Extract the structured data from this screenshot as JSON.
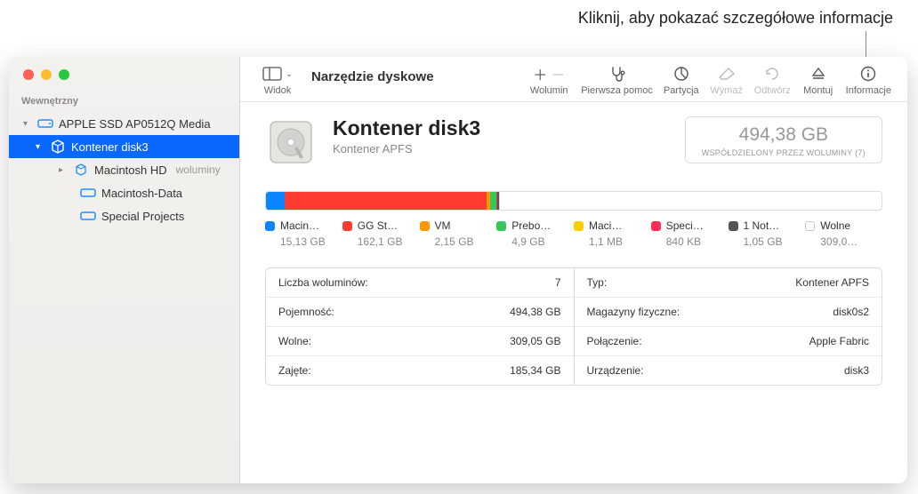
{
  "callout": "Kliknij, aby pokazać szczegółowe informacje",
  "toolbar": {
    "title": "Narzędzie dyskowe",
    "view": "Widok",
    "volume": "Wolumin",
    "firstaid": "Pierwsza pomoc",
    "partition": "Partycja",
    "erase": "Wymaż",
    "restore": "Odtwórz",
    "mount": "Montuj",
    "info": "Informacje"
  },
  "sidebar": {
    "section": "Wewnętrzny",
    "items": [
      {
        "label": "APPLE SSD AP0512Q Media"
      },
      {
        "label": "Kontener disk3"
      },
      {
        "label": "Macintosh HD",
        "suffix": "woluminy"
      },
      {
        "label": "Macintosh-Data"
      },
      {
        "label": "Special Projects"
      }
    ]
  },
  "disk": {
    "title": "Kontener disk3",
    "subtitle": "Kontener APFS",
    "size": "494,38 GB",
    "shared": "WSPÓŁDZIELONY PRZEZ WOLUMINY (7)"
  },
  "segments": [
    {
      "name": "Macin…",
      "size": "15,13 GB",
      "color": "#0a84ff",
      "pct": 3.1
    },
    {
      "name": "GG St…",
      "size": "162,1 GB",
      "color": "#ff3b30",
      "pct": 32.8
    },
    {
      "name": "VM",
      "size": "2,15 GB",
      "color": "#ff9500",
      "pct": 0.5
    },
    {
      "name": "Prebo…",
      "size": "4,9 GB",
      "color": "#34c759",
      "pct": 1.0
    },
    {
      "name": "Maci…",
      "size": "1,1 MB",
      "color": "#ffcc00",
      "pct": 0.1
    },
    {
      "name": "Speci…",
      "size": "840 KB",
      "color": "#ff2d55",
      "pct": 0.1
    },
    {
      "name": "1 Not…",
      "size": "1,05 GB",
      "color": "#555555",
      "pct": 0.3
    },
    {
      "name": "Wolne",
      "size": "309,0…",
      "color": "#ffffff",
      "pct": 62.1,
      "hollow": true
    }
  ],
  "info": {
    "left": [
      {
        "k": "Liczba woluminów:",
        "v": "7"
      },
      {
        "k": "Pojemność:",
        "v": "494,38 GB"
      },
      {
        "k": "Wolne:",
        "v": "309,05 GB"
      },
      {
        "k": "Zajęte:",
        "v": "185,34 GB"
      }
    ],
    "right": [
      {
        "k": "Typ:",
        "v": "Kontener APFS"
      },
      {
        "k": "Magazyny fizyczne:",
        "v": "disk0s2"
      },
      {
        "k": "Połączenie:",
        "v": "Apple Fabric"
      },
      {
        "k": "Urządzenie:",
        "v": "disk3"
      }
    ]
  }
}
